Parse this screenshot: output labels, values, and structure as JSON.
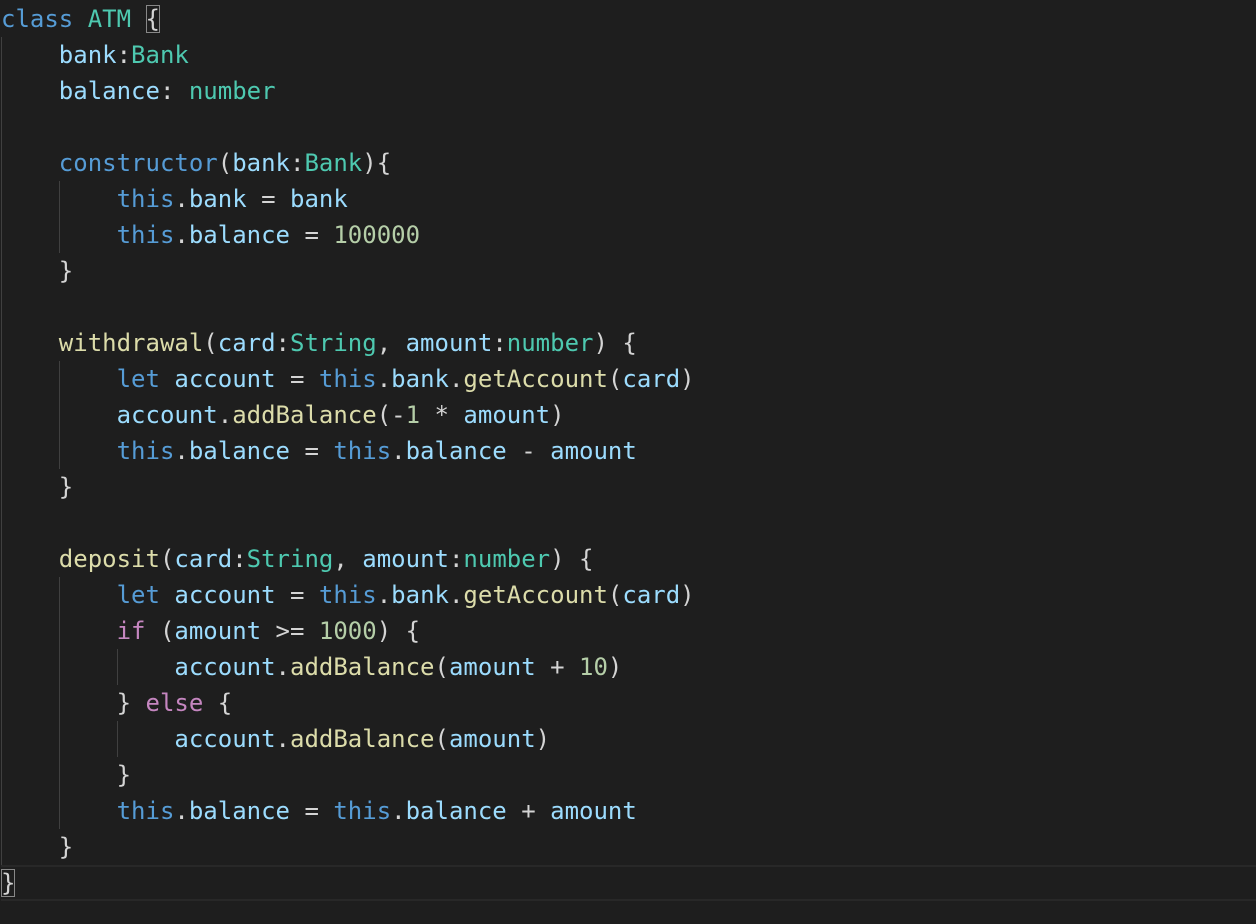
{
  "editor": {
    "lines": [
      [
        {
          "t": "keyword",
          "v": "class"
        },
        {
          "t": "punct",
          "v": " "
        },
        {
          "t": "type",
          "v": "ATM"
        },
        {
          "t": "punct",
          "v": " "
        },
        {
          "t": "punct",
          "v": "{",
          "match": true
        }
      ],
      [
        {
          "t": "punct",
          "v": "    "
        },
        {
          "t": "prop",
          "v": "bank"
        },
        {
          "t": "punct",
          "v": ":"
        },
        {
          "t": "type",
          "v": "Bank"
        }
      ],
      [
        {
          "t": "punct",
          "v": "    "
        },
        {
          "t": "prop",
          "v": "balance"
        },
        {
          "t": "punct",
          "v": ": "
        },
        {
          "t": "type",
          "v": "number"
        }
      ],
      [],
      [
        {
          "t": "punct",
          "v": "    "
        },
        {
          "t": "keyword",
          "v": "constructor"
        },
        {
          "t": "punct",
          "v": "("
        },
        {
          "t": "prop",
          "v": "bank"
        },
        {
          "t": "punct",
          "v": ":"
        },
        {
          "t": "type",
          "v": "Bank"
        },
        {
          "t": "punct",
          "v": "){"
        }
      ],
      [
        {
          "t": "punct",
          "v": "        "
        },
        {
          "t": "keyword",
          "v": "this"
        },
        {
          "t": "punct",
          "v": "."
        },
        {
          "t": "prop",
          "v": "bank"
        },
        {
          "t": "punct",
          "v": " = "
        },
        {
          "t": "prop",
          "v": "bank"
        }
      ],
      [
        {
          "t": "punct",
          "v": "        "
        },
        {
          "t": "keyword",
          "v": "this"
        },
        {
          "t": "punct",
          "v": "."
        },
        {
          "t": "prop",
          "v": "balance"
        },
        {
          "t": "punct",
          "v": " = "
        },
        {
          "t": "number",
          "v": "100000"
        }
      ],
      [
        {
          "t": "punct",
          "v": "    }"
        }
      ],
      [],
      [
        {
          "t": "punct",
          "v": "    "
        },
        {
          "t": "func",
          "v": "withdrawal"
        },
        {
          "t": "punct",
          "v": "("
        },
        {
          "t": "prop",
          "v": "card"
        },
        {
          "t": "punct",
          "v": ":"
        },
        {
          "t": "type",
          "v": "String"
        },
        {
          "t": "punct",
          "v": ", "
        },
        {
          "t": "prop",
          "v": "amount"
        },
        {
          "t": "punct",
          "v": ":"
        },
        {
          "t": "type",
          "v": "number"
        },
        {
          "t": "punct",
          "v": ") {"
        }
      ],
      [
        {
          "t": "punct",
          "v": "        "
        },
        {
          "t": "keyword",
          "v": "let"
        },
        {
          "t": "punct",
          "v": " "
        },
        {
          "t": "prop",
          "v": "account"
        },
        {
          "t": "punct",
          "v": " = "
        },
        {
          "t": "keyword",
          "v": "this"
        },
        {
          "t": "punct",
          "v": "."
        },
        {
          "t": "prop",
          "v": "bank"
        },
        {
          "t": "punct",
          "v": "."
        },
        {
          "t": "func",
          "v": "getAccount"
        },
        {
          "t": "punct",
          "v": "("
        },
        {
          "t": "prop",
          "v": "card"
        },
        {
          "t": "punct",
          "v": ")"
        }
      ],
      [
        {
          "t": "punct",
          "v": "        "
        },
        {
          "t": "prop",
          "v": "account"
        },
        {
          "t": "punct",
          "v": "."
        },
        {
          "t": "func",
          "v": "addBalance"
        },
        {
          "t": "punct",
          "v": "(-"
        },
        {
          "t": "number",
          "v": "1"
        },
        {
          "t": "punct",
          "v": " * "
        },
        {
          "t": "prop",
          "v": "amount"
        },
        {
          "t": "punct",
          "v": ")"
        }
      ],
      [
        {
          "t": "punct",
          "v": "        "
        },
        {
          "t": "keyword",
          "v": "this"
        },
        {
          "t": "punct",
          "v": "."
        },
        {
          "t": "prop",
          "v": "balance"
        },
        {
          "t": "punct",
          "v": " = "
        },
        {
          "t": "keyword",
          "v": "this"
        },
        {
          "t": "punct",
          "v": "."
        },
        {
          "t": "prop",
          "v": "balance"
        },
        {
          "t": "punct",
          "v": " - "
        },
        {
          "t": "prop",
          "v": "amount"
        }
      ],
      [
        {
          "t": "punct",
          "v": "    }"
        }
      ],
      [],
      [
        {
          "t": "punct",
          "v": "    "
        },
        {
          "t": "func",
          "v": "deposit"
        },
        {
          "t": "punct",
          "v": "("
        },
        {
          "t": "prop",
          "v": "card"
        },
        {
          "t": "punct",
          "v": ":"
        },
        {
          "t": "type",
          "v": "String"
        },
        {
          "t": "punct",
          "v": ", "
        },
        {
          "t": "prop",
          "v": "amount"
        },
        {
          "t": "punct",
          "v": ":"
        },
        {
          "t": "type",
          "v": "number"
        },
        {
          "t": "punct",
          "v": ") {"
        }
      ],
      [
        {
          "t": "punct",
          "v": "        "
        },
        {
          "t": "keyword",
          "v": "let"
        },
        {
          "t": "punct",
          "v": " "
        },
        {
          "t": "prop",
          "v": "account"
        },
        {
          "t": "punct",
          "v": " = "
        },
        {
          "t": "keyword",
          "v": "this"
        },
        {
          "t": "punct",
          "v": "."
        },
        {
          "t": "prop",
          "v": "bank"
        },
        {
          "t": "punct",
          "v": "."
        },
        {
          "t": "func",
          "v": "getAccount"
        },
        {
          "t": "punct",
          "v": "("
        },
        {
          "t": "prop",
          "v": "card"
        },
        {
          "t": "punct",
          "v": ")"
        }
      ],
      [
        {
          "t": "punct",
          "v": "        "
        },
        {
          "t": "control",
          "v": "if"
        },
        {
          "t": "punct",
          "v": " ("
        },
        {
          "t": "prop",
          "v": "amount"
        },
        {
          "t": "punct",
          "v": " >= "
        },
        {
          "t": "number",
          "v": "1000"
        },
        {
          "t": "punct",
          "v": ") {"
        }
      ],
      [
        {
          "t": "punct",
          "v": "            "
        },
        {
          "t": "prop",
          "v": "account"
        },
        {
          "t": "punct",
          "v": "."
        },
        {
          "t": "func",
          "v": "addBalance"
        },
        {
          "t": "punct",
          "v": "("
        },
        {
          "t": "prop",
          "v": "amount"
        },
        {
          "t": "punct",
          "v": " + "
        },
        {
          "t": "number",
          "v": "10"
        },
        {
          "t": "punct",
          "v": ")"
        }
      ],
      [
        {
          "t": "punct",
          "v": "        } "
        },
        {
          "t": "control",
          "v": "else"
        },
        {
          "t": "punct",
          "v": " {"
        }
      ],
      [
        {
          "t": "punct",
          "v": "            "
        },
        {
          "t": "prop",
          "v": "account"
        },
        {
          "t": "punct",
          "v": "."
        },
        {
          "t": "func",
          "v": "addBalance"
        },
        {
          "t": "punct",
          "v": "("
        },
        {
          "t": "prop",
          "v": "amount"
        },
        {
          "t": "punct",
          "v": ")"
        }
      ],
      [
        {
          "t": "punct",
          "v": "        }"
        }
      ],
      [
        {
          "t": "punct",
          "v": "        "
        },
        {
          "t": "keyword",
          "v": "this"
        },
        {
          "t": "punct",
          "v": "."
        },
        {
          "t": "prop",
          "v": "balance"
        },
        {
          "t": "punct",
          "v": " = "
        },
        {
          "t": "keyword",
          "v": "this"
        },
        {
          "t": "punct",
          "v": "."
        },
        {
          "t": "prop",
          "v": "balance"
        },
        {
          "t": "punct",
          "v": " + "
        },
        {
          "t": "prop",
          "v": "amount"
        }
      ],
      [
        {
          "t": "punct",
          "v": "    }"
        }
      ],
      [
        {
          "t": "punct",
          "v": "}",
          "match": true
        }
      ]
    ],
    "current_line": 24
  }
}
